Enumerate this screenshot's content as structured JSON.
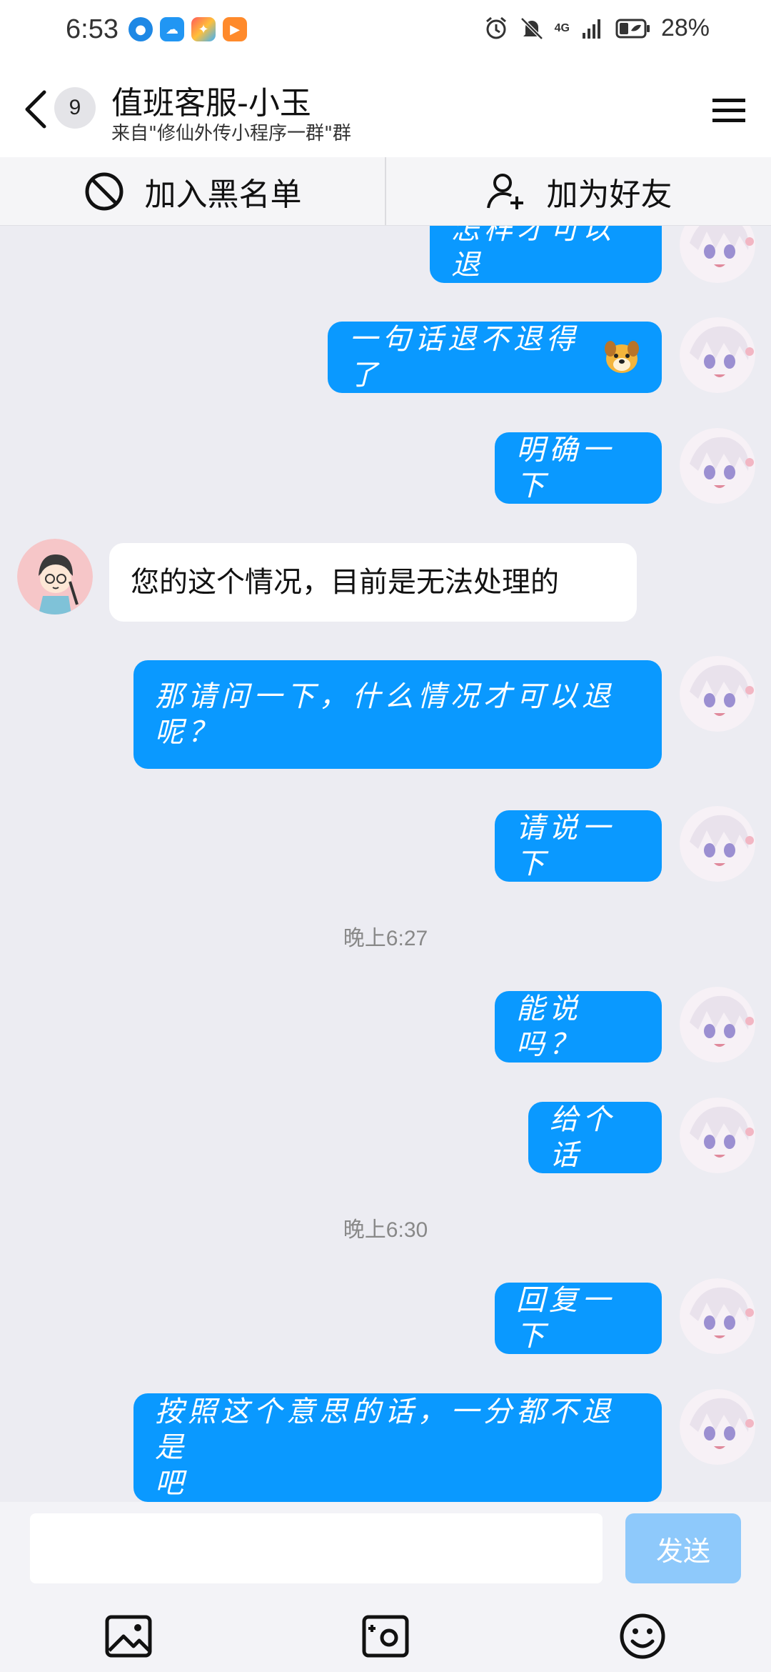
{
  "status_bar": {
    "time": "6:53",
    "network": "4G",
    "battery": "28%",
    "app_icons": [
      "browser-icon",
      "cloud-icon",
      "app-store-icon",
      "video-icon"
    ]
  },
  "header": {
    "unread_count": "9",
    "title": "值班客服-小玉",
    "subtitle": "来自\"修仙外传小程序一群\"群"
  },
  "actions": {
    "blacklist_label": "加入黑名单",
    "add_friend_label": "加为好友"
  },
  "messages": [
    {
      "sender": "self",
      "text": "怎样才可以退"
    },
    {
      "sender": "self",
      "text": "一句话退不退得了"
    },
    {
      "sender": "self",
      "text": "明确一下"
    },
    {
      "sender": "other",
      "text": "您的这个情况，目前是无法处理的"
    },
    {
      "sender": "self",
      "text": "那请问一下，什么情况才可以退",
      "text_line2": "呢？"
    },
    {
      "sender": "self",
      "text": "请说一下"
    },
    {
      "sender": "system",
      "text": "晚上6:27"
    },
    {
      "sender": "self",
      "text": "能说吗？"
    },
    {
      "sender": "self",
      "text": "给个话"
    },
    {
      "sender": "system",
      "text": "晚上6:30"
    },
    {
      "sender": "self",
      "text": "回复一下"
    },
    {
      "sender": "self",
      "text": "按照这个意思的话，一分都不退是",
      "text_line2": "吧"
    }
  ],
  "composer": {
    "input_value": "",
    "send_label": "发送"
  },
  "colors": {
    "self_bubble": "#0a99ff",
    "other_bubble": "#ffffff",
    "send_disabled": "#8ec9fb",
    "background": "#ececf2"
  }
}
